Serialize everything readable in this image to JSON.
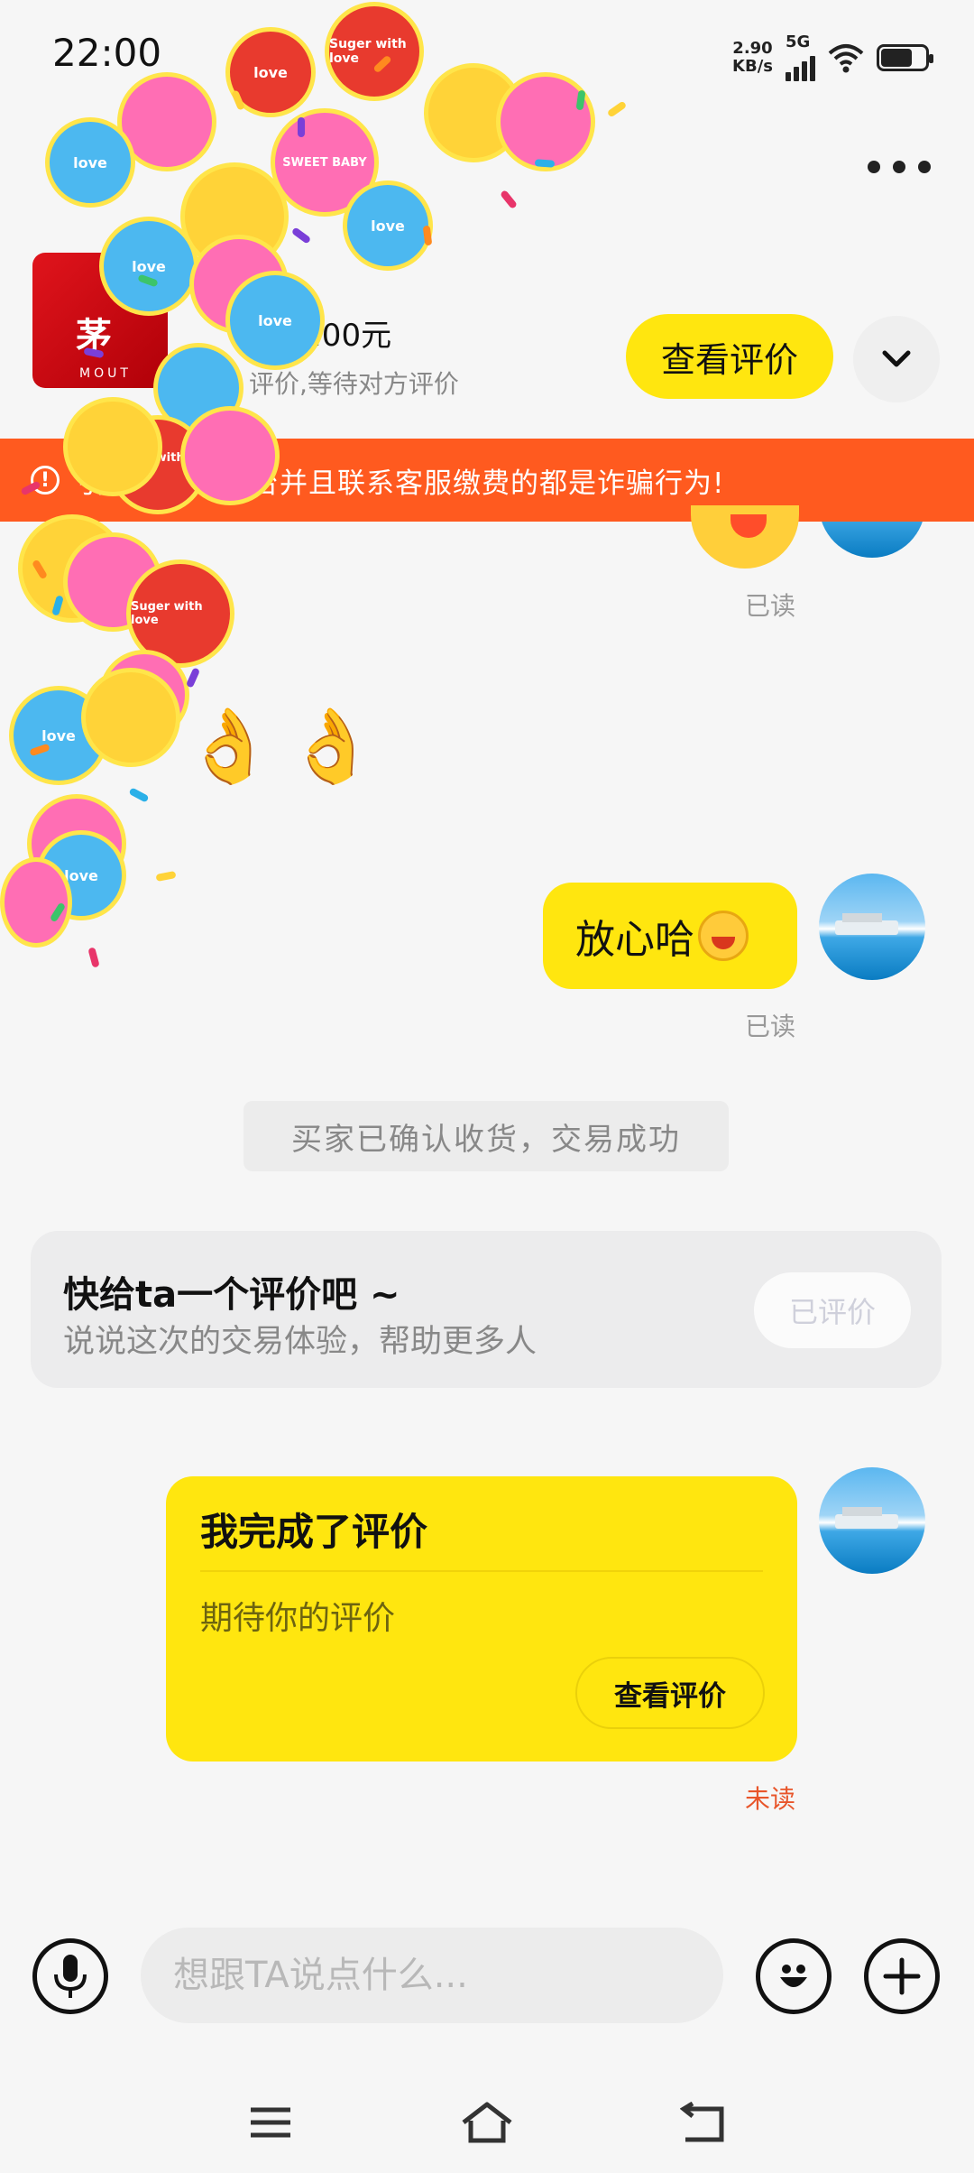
{
  "status_bar": {
    "time": "22:00",
    "net_speed_value": "2.90",
    "net_speed_unit": "KB/s",
    "network_type": "5G",
    "battery_level": 0.7
  },
  "header": {
    "more_icon": "more-dots-icon"
  },
  "product": {
    "thumb_text": "茅",
    "thumb_sub": "MOUT",
    "price": ".00元",
    "status": "评价,等待对方评价",
    "view_review_label": "查看评价",
    "collapse_icon": "chevron-down-icon"
  },
  "warning": {
    "icon_text": "!",
    "text": "引导至闲鱼平台并且联系客服缴费的都是诈骗行为!"
  },
  "chat": {
    "read_label": "已读",
    "message_text": "放心哈",
    "system_message": "买家已确认收货，交易成功",
    "review_prompt": {
      "title": "快给ta一个评价吧 ~",
      "subtitle": "说说这次的交易体验，帮助更多人",
      "button_label": "已评价"
    },
    "review_card": {
      "title": "我完成了评价",
      "subtitle": "期待你的评价",
      "button_label": "查看评价"
    },
    "unread_label": "未读"
  },
  "input_bar": {
    "placeholder": "想跟TA说点什么..."
  },
  "colors": {
    "accent_yellow": "#ffe60f",
    "warning_orange": "#ff5a1f",
    "unread_red": "#e8552a"
  },
  "stickers": {
    "sticker_text_1": "love",
    "sticker_text_2": "Suger with love",
    "sticker_text_3": "SWEET BABY"
  }
}
